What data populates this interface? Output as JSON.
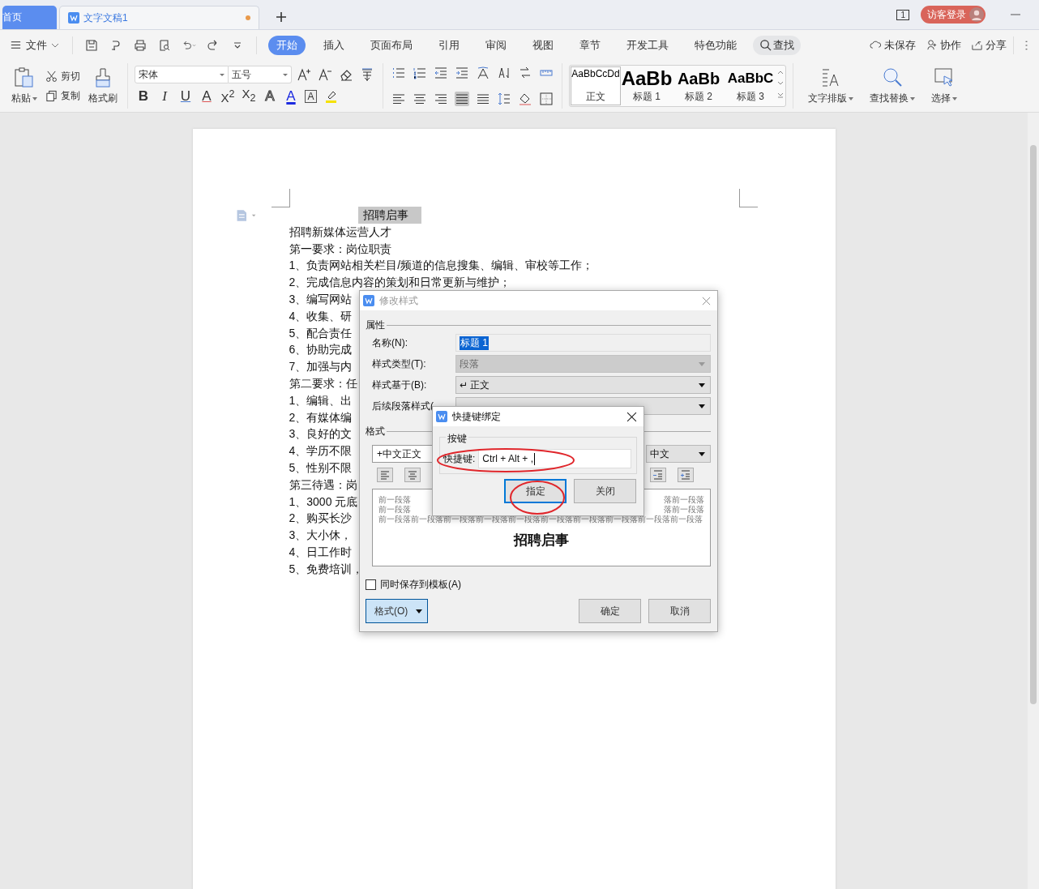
{
  "tabs": [
    {
      "label": "首页",
      "kind": "home",
      "selected": false,
      "modified": false
    },
    {
      "label": "文字文稿1",
      "kind": "document",
      "selected": true,
      "modified": true
    }
  ],
  "title_bar": {
    "window_count": "1",
    "login": "访客登录"
  },
  "menu": {
    "file": "文件",
    "ribbon_tabs": [
      {
        "label": "开始",
        "selected": true
      },
      {
        "label": "插入",
        "selected": false
      },
      {
        "label": "页面布局",
        "selected": false
      },
      {
        "label": "引用",
        "selected": false
      },
      {
        "label": "审阅",
        "selected": false
      },
      {
        "label": "视图",
        "selected": false
      },
      {
        "label": "章节",
        "selected": false
      },
      {
        "label": "开发工具",
        "selected": false
      },
      {
        "label": "特色功能",
        "selected": false
      }
    ],
    "search": "查找",
    "actions": [
      "未保存",
      "协作",
      "分享"
    ]
  },
  "ribbon": {
    "paste": "粘贴",
    "cut": "剪切",
    "copy": "复制",
    "format_painter": "格式刷",
    "font": "宋体",
    "size": "五号",
    "format_glyphs": [
      {
        "text": "B",
        "kind": "bold"
      },
      {
        "text": "I",
        "kind": "italic"
      },
      {
        "text": "U",
        "kind": "underline"
      },
      {
        "text": "A",
        "kind": "strike"
      },
      {
        "text": "X$^{2}$",
        "kind": "plain"
      },
      {
        "text": "X$_{2}$",
        "kind": "plain"
      },
      {
        "text": "A",
        "kind": "outline"
      },
      {
        "text": "A",
        "kind": "color"
      },
      {
        "text": "A",
        "kind": "boxed"
      }
    ],
    "alignment": [
      {
        "kind": "left",
        "selected": false
      },
      {
        "kind": "center",
        "selected": false
      },
      {
        "kind": "right",
        "selected": false
      },
      {
        "kind": "justify",
        "selected": true
      },
      {
        "kind": "distributed",
        "selected": false
      }
    ],
    "styles": [
      {
        "preview": "AaBbCcDd",
        "label": "正文",
        "kind": "normal",
        "selected": true
      },
      {
        "preview": "AaBb",
        "label": "标题 1",
        "kind": "h1",
        "selected": false
      },
      {
        "preview": "AaBb",
        "label": "标题 2",
        "kind": "h2",
        "selected": false
      },
      {
        "preview": "AaBbC",
        "label": "标题 3",
        "kind": "h3",
        "selected": false
      }
    ],
    "big_buttons": [
      "文字排版",
      "查找替换",
      "选择"
    ]
  },
  "document": {
    "heading": "招聘启事",
    "lines": [
      "招聘新媒体运营人才",
      "第一要求：岗位职责",
      "1、负责网站相关栏目/频道的信息搜集、编辑、审校等工作；",
      "2、完成信息内容的策划和日常更新与维护；",
      "3、编写网站",
      "4、收集、研",
      "5、配合责任",
      "6、协助完成",
      "7、加强与内",
      "第二要求：任",
      "1、编辑、出",
      "2、有媒体编",
      "3、良好的文",
      "4、学历不限",
      "5、性别不限",
      "第三待遇：岗",
      "1、3000 元底",
      "2、购买长沙",
      "3、大小休，",
      "4、日工作时",
      "5、免费培训，"
    ]
  },
  "modify_style_dialog": {
    "title": "修改样式",
    "properties_header": "属性",
    "fields": [
      {
        "label": "名称(N):",
        "value": "标题 1",
        "kind": "text",
        "selected": true
      },
      {
        "label": "样式类型(T):",
        "value": "段落",
        "kind": "dropdown",
        "disabled": true
      },
      {
        "label": "样式基于(B):",
        "value": "↵ 正文",
        "kind": "dropdown",
        "disabled": false
      },
      {
        "label": "后续段落样式(",
        "kind": "dropdown",
        "disabled": false
      }
    ],
    "format_header": "格式",
    "font": "+中文正文",
    "language": "中文",
    "preview_rows": [
      {
        "left": "前一段落",
        "right": "落前一段落"
      },
      {
        "left": "前一段落",
        "right": "落前一段落"
      },
      {
        "left": "前一段落前一段落前一段落前一段落前一段落前一段落前一段落前一段落前一段落前一段落"
      }
    ],
    "preview_heading": "招聘启事",
    "save_to_template": {
      "label": "同时保存到模板(A)",
      "checked": false
    },
    "format_button": "格式(O)",
    "ok": "确定",
    "cancel": "取消"
  },
  "shortcut_dialog": {
    "title": "快捷键绑定",
    "group": "按键",
    "label": "快捷键:",
    "value": "Ctrl + Alt + ,",
    "assign": "指定",
    "close": "关闭"
  }
}
